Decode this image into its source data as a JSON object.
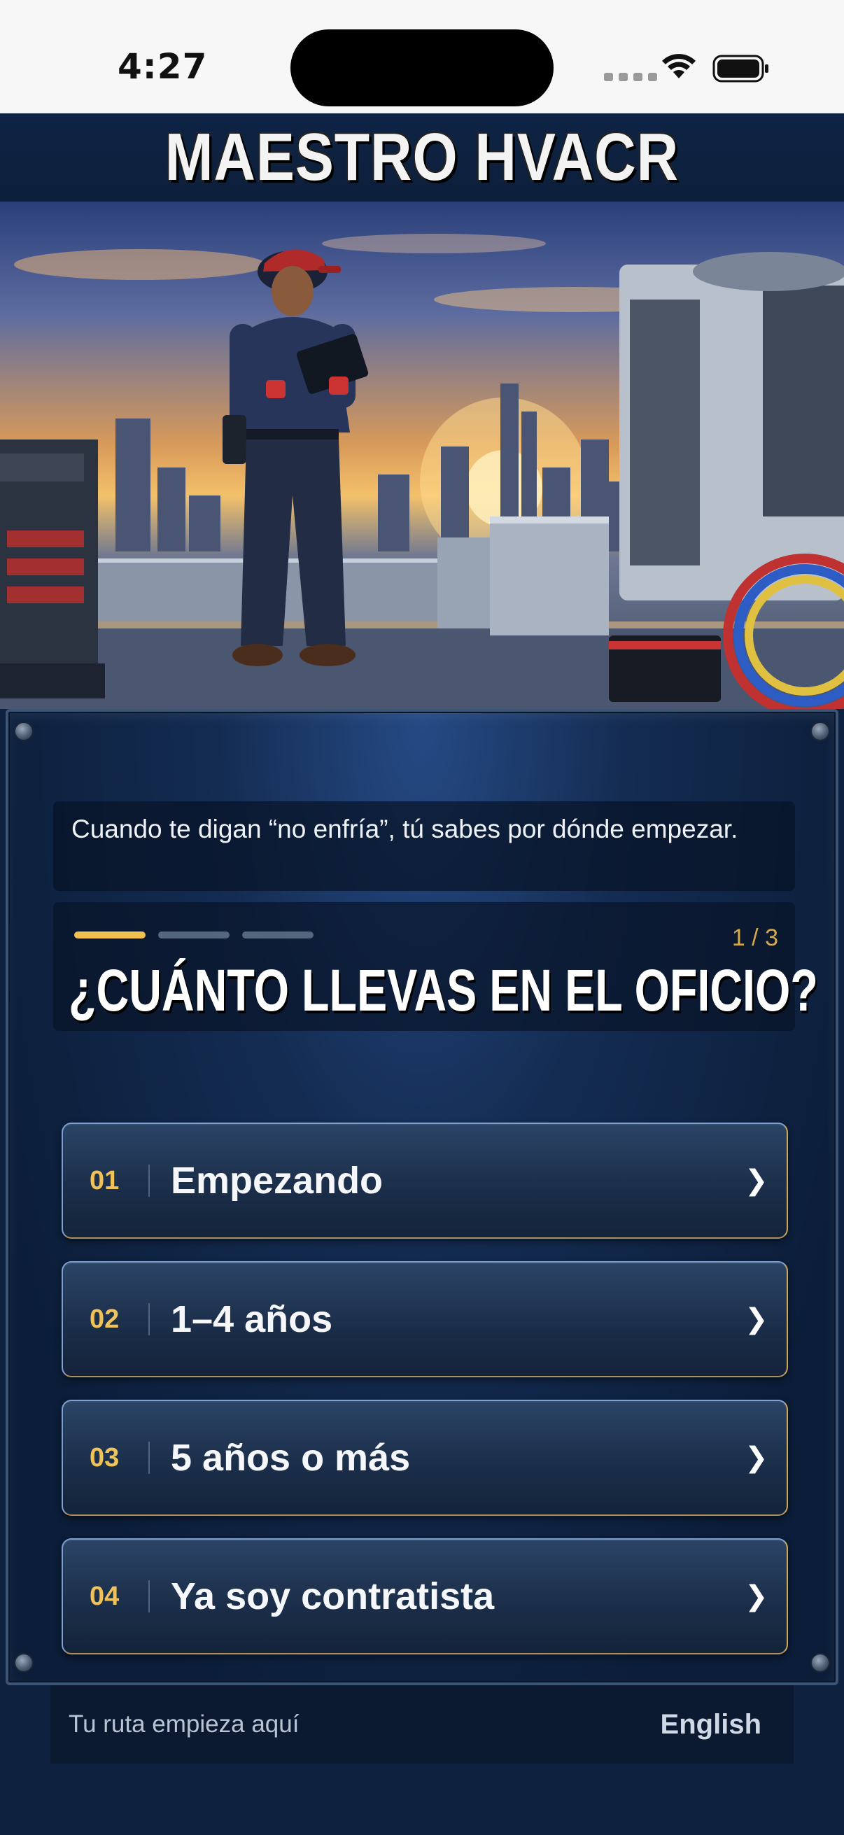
{
  "status_bar": {
    "time": "4:27"
  },
  "header": {
    "title": "MAESTRO HVACR"
  },
  "intro": {
    "tagline": "Cuando te digan “no enfría”, tú sabes por dónde empezar."
  },
  "quiz": {
    "step_label": "1 / 3",
    "progress": {
      "current": 1,
      "total": 3
    },
    "question": "¿CUÁNTO LLEVAS EN EL OFICIO?",
    "options": [
      {
        "number": "01",
        "label": "Empezando"
      },
      {
        "number": "02",
        "label": "1–4 años"
      },
      {
        "number": "03",
        "label": "5 años o más"
      },
      {
        "number": "04",
        "label": "Ya soy contratista"
      }
    ],
    "chevron_glyph": "❯"
  },
  "footer": {
    "note": "Tu ruta empieza aquí",
    "language_link": "English"
  },
  "colors": {
    "navy": "#0e2240",
    "gold": "#f1c04f",
    "option_border": "#7fa0cf"
  }
}
